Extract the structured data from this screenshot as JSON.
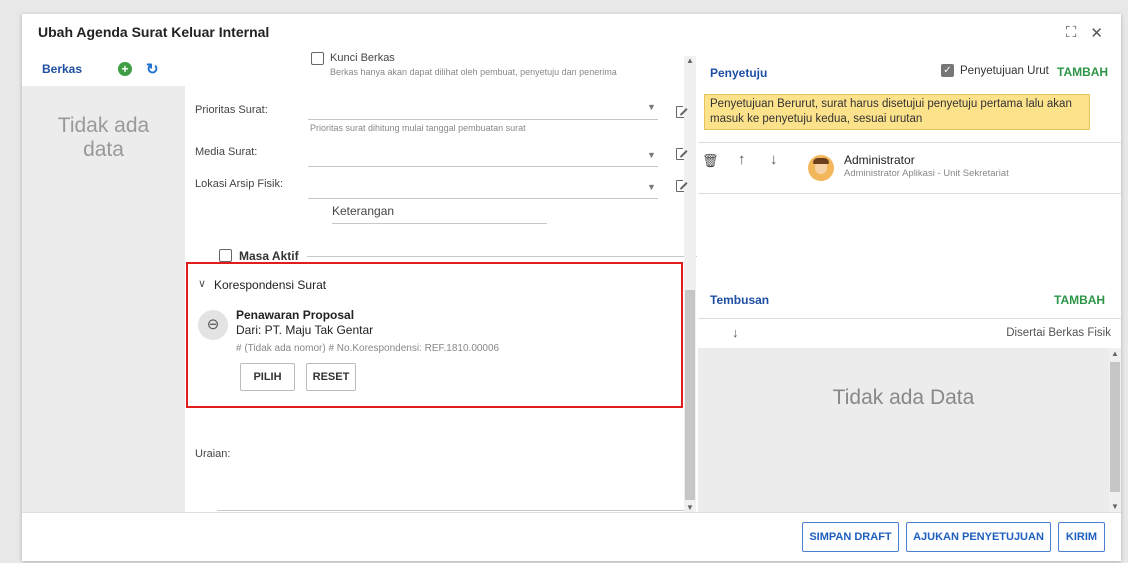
{
  "dialog": {
    "title": "Ubah Agenda Surat Keluar Internal"
  },
  "berkas": {
    "label": "Berkas",
    "empty_line1": "Tidak ada",
    "empty_line2": "data"
  },
  "form": {
    "kunci_berkas_label": "Kunci Berkas",
    "kunci_berkas_hint": "Berkas hanya akan dapat dilihat oleh pembuat, penyetuju dan penerima",
    "prioritas_label": "Prioritas Surat:",
    "prioritas_hint": "Prioritas surat dihitung mulai tanggal pembuatan surat",
    "media_label": "Media Surat:",
    "lokasi_label": "Lokasi Arsip Fisik:",
    "keterangan_placeholder": "Keterangan",
    "masa_aktif_label": "Masa Aktif",
    "uraian_label": "Uraian:"
  },
  "korespondensi": {
    "title": "Korespondensi Surat",
    "name": "Penawaran Proposal",
    "from": "Dari: PT. Maju Tak Gentar",
    "meta": "# (Tidak ada nomor)   # No.Korespondensi: REF.1810.00006",
    "pilih_label": "PILIH",
    "reset_label": "RESET"
  },
  "penyetuju": {
    "label": "Penyetuju",
    "urut_label": "Penyetujuan Urut",
    "tambah_label": "TAMBAH",
    "notice": "Penyetujuan Berurut, surat harus disetujui penyetuju pertama lalu akan masuk ke penyetuju kedua, sesuai urutan",
    "approver_name": "Administrator",
    "approver_role": "Administrator Aplikasi - Unit Sekretariat"
  },
  "tembusan": {
    "label": "Tembusan",
    "tambah_label": "TAMBAH",
    "col_fisik": "Disertai Berkas Fisik",
    "empty": "Tidak ada Data"
  },
  "footer": {
    "simpan_label": "SIMPAN DRAFT",
    "ajukan_label": "AJUKAN PENYETUJUAN",
    "kirim_label": "KIRIM"
  },
  "colors": {
    "accent_blue": "#1f4fa3",
    "green": "#2e9447",
    "highlight_red": "#e01c1c",
    "notice_yellow": "#fde28c"
  }
}
